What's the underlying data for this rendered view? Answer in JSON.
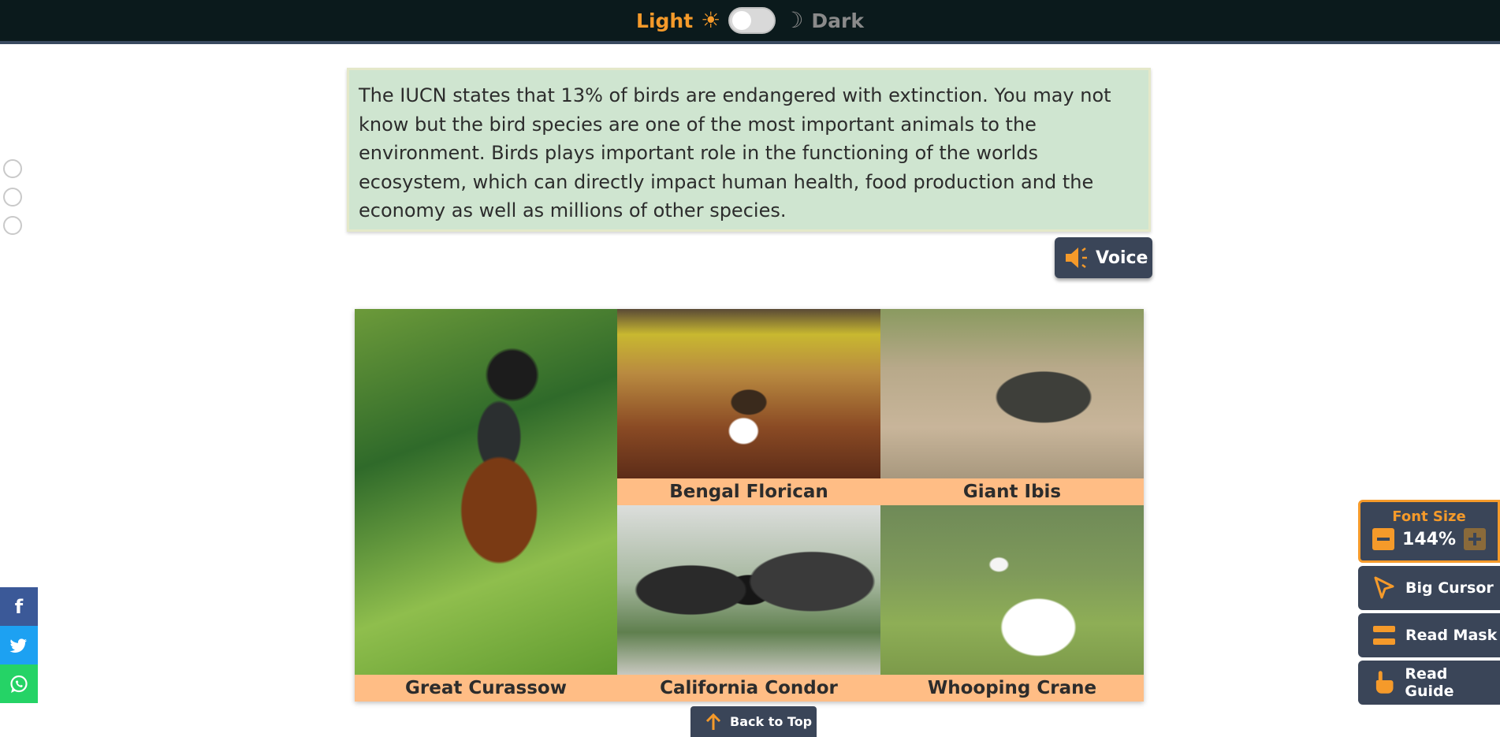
{
  "theme_toggle": {
    "light_label": "Light",
    "dark_label": "Dark",
    "sun_glyph": "☀",
    "moon_glyph": "☽",
    "state": "light"
  },
  "info": {
    "text": "The IUCN states that 13% of birds are endangered with extinction. You may not know but the bird species are one of the most important animals to the environment. Birds plays important role in the functioning of the worlds ecosystem, which can directly impact human health, food production and the economy as well as millions of other species."
  },
  "voice_button": {
    "label": "Voice",
    "icon": "speaker-icon"
  },
  "gallery": {
    "birds": [
      {
        "name": "Great Curassow"
      },
      {
        "name": "Bengal Florican"
      },
      {
        "name": "Giant Ibis"
      },
      {
        "name": "California Condor"
      },
      {
        "name": "Whooping Crane"
      }
    ]
  },
  "back_to_top": {
    "label": "Back to Top",
    "icon": "arrow-up-icon"
  },
  "social": [
    {
      "network": "facebook",
      "icon": "facebook-icon",
      "glyph": "f"
    },
    {
      "network": "twitter",
      "icon": "twitter-icon"
    },
    {
      "network": "whatsapp",
      "icon": "whatsapp-icon"
    }
  ],
  "accessibility": {
    "font_size_title": "Font Size",
    "font_size_value": "144%",
    "big_cursor_label": "Big Cursor",
    "read_mask_label": "Read Mask",
    "read_guide_label": "Read Guide"
  },
  "colors": {
    "accent": "#f59a2a",
    "panel": "#3a4558",
    "topbar": "#0b1a1c",
    "info_bg": "#cfe5d0",
    "caption_bg": "#ffbd85"
  }
}
